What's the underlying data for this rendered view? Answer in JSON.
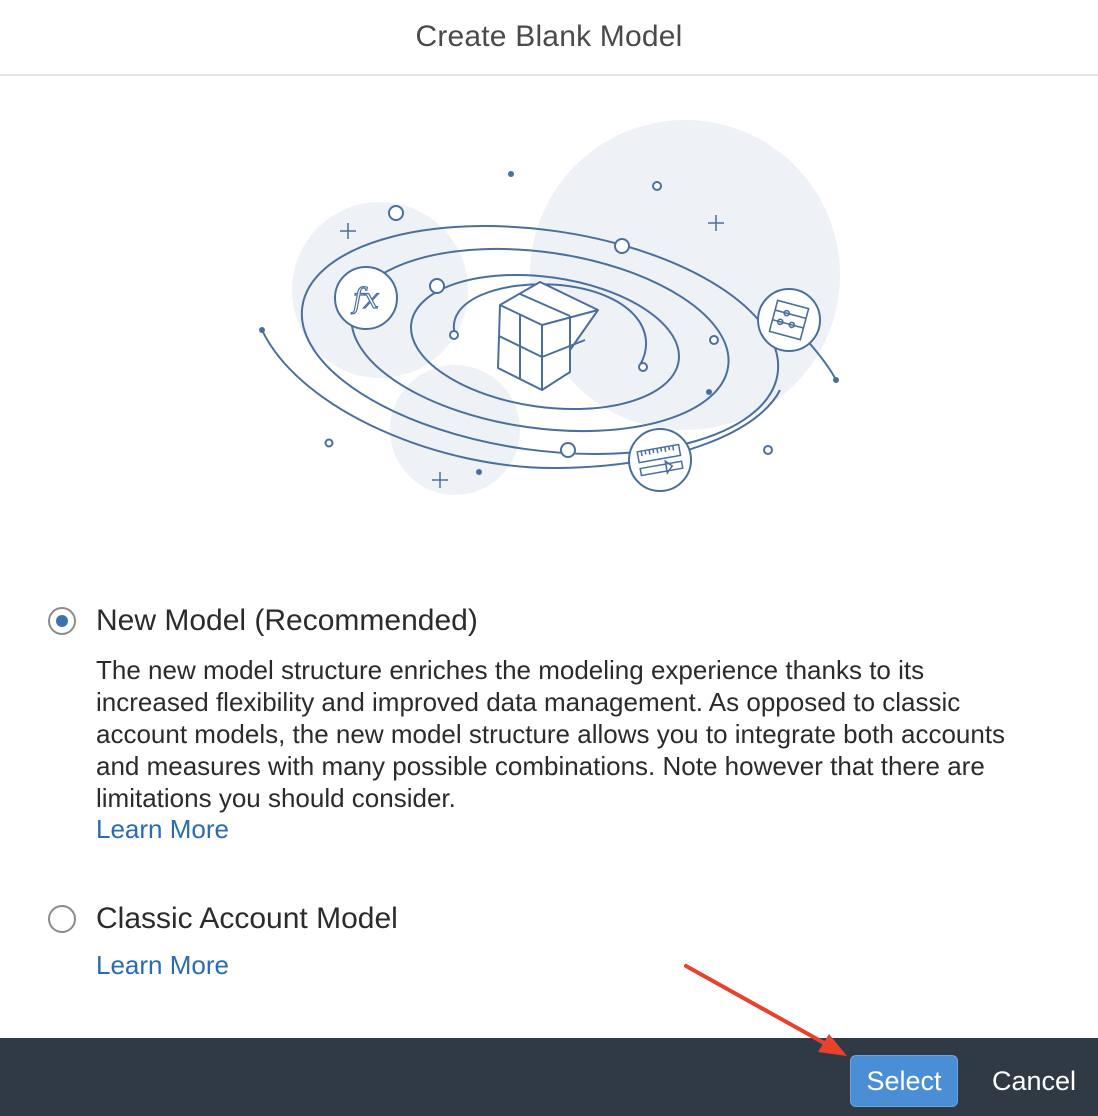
{
  "dialog": {
    "title": "Create Blank Model"
  },
  "options": [
    {
      "label": "New Model (Recommended)",
      "selected": true,
      "description": "The new model structure enriches the modeling experience thanks to its increased flexibility and improved data management. As opposed to classic account models, the new model structure allows you to integrate both accounts and measures with many possible combinations. Note however that there are limitations you should consider.",
      "link": "Learn More"
    },
    {
      "label": "Classic Account Model",
      "selected": false,
      "link": "Learn More"
    }
  ],
  "footer": {
    "select_label": "Select",
    "cancel_label": "Cancel"
  },
  "illustration": {
    "icons": [
      "cube-icon",
      "function-fx-icon",
      "abacus-icon",
      "ruler-icon"
    ]
  },
  "colors": {
    "accent": "#3a72b0",
    "link": "#2a6cb0",
    "footer_bg": "#2f3a45",
    "select_button": "#4a8fd6",
    "annotation_arrow": "#e8412c",
    "illustration_line": "#4a6f9c",
    "illustration_bg": "#eef1f6"
  }
}
